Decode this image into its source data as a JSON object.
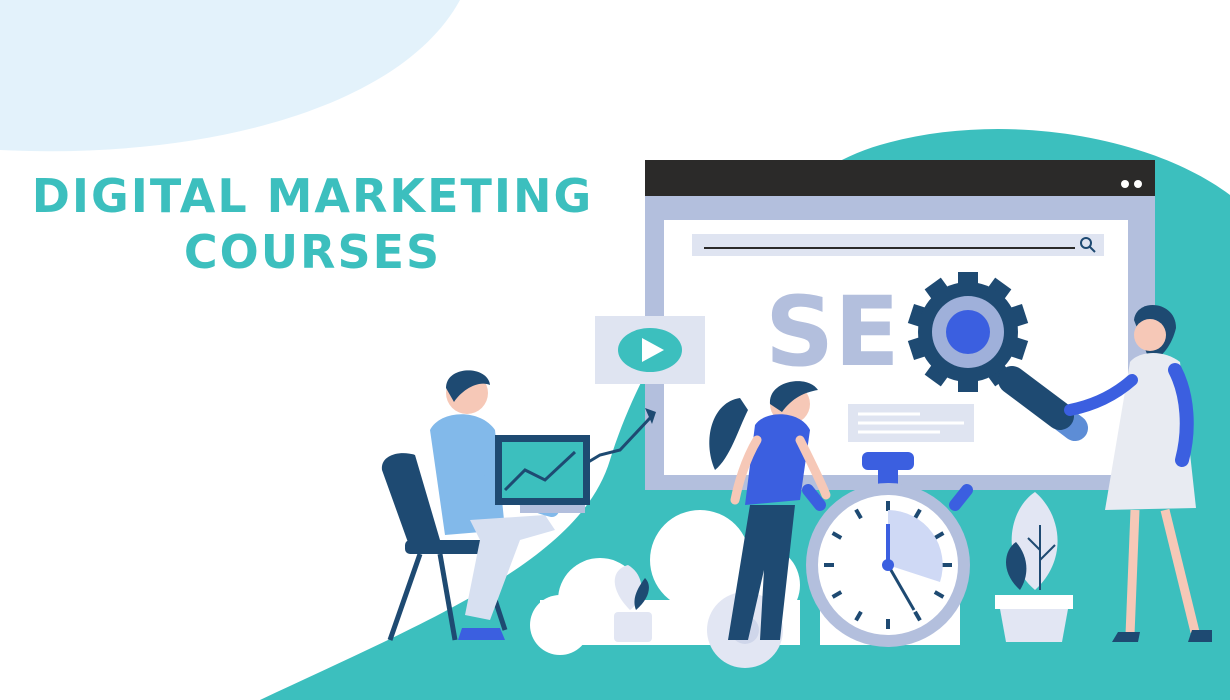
{
  "headline": {
    "line1": "DIGITAL MARKETING",
    "line2": "COURSES"
  },
  "screen": {
    "seo_text": "SE"
  },
  "colors": {
    "teal": "#3cbfbe",
    "light_teal": "#cdeeee",
    "corner_blue": "#e3f2fb",
    "screen_frame": "#b3bfdd",
    "window_bar": "#2b2a29",
    "navy": "#1e4a72",
    "royal_blue": "#3b5fe0",
    "skin": "#f6c8b7"
  },
  "icons": [
    "search-icon",
    "play-icon",
    "gear-icon",
    "magnifier-icon",
    "stopwatch-icon",
    "trend-arrow-icon",
    "plant-icon",
    "cloud-icon"
  ]
}
